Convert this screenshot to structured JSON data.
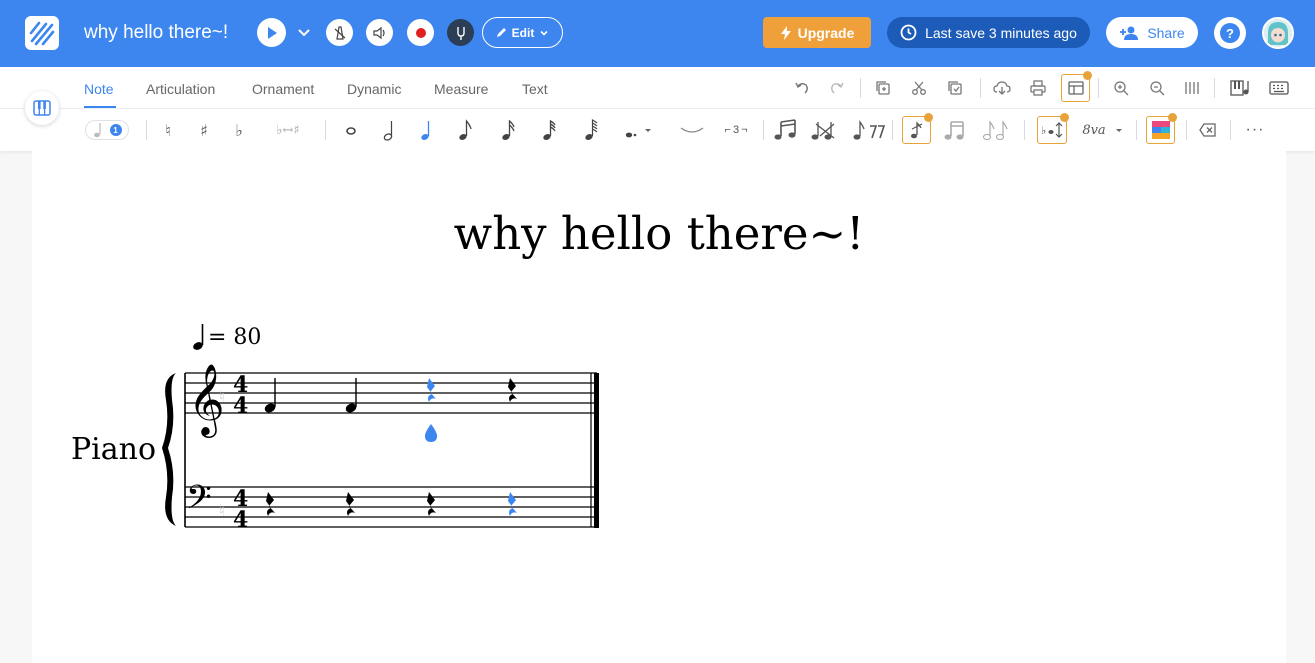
{
  "header": {
    "title": "why hello there~!",
    "edit_label": "Edit",
    "upgrade_label": "Upgrade",
    "last_save": "Last save 3 minutes ago",
    "share_label": "Share",
    "help_glyph": "?"
  },
  "tabs": [
    {
      "label": "Note",
      "active": true
    },
    {
      "label": "Articulation"
    },
    {
      "label": "Ornament"
    },
    {
      "label": "Dynamic"
    },
    {
      "label": "Measure"
    },
    {
      "label": "Text"
    }
  ],
  "note_toolbar": {
    "voice_badge": "1",
    "triplet_label": "3",
    "ottava_label": "8va"
  },
  "score": {
    "title": "why hello there~!",
    "tempo_value": "= 80",
    "instrument": "Piano",
    "time_signature_top": "4",
    "time_signature_bottom": "4",
    "treble_notes": [
      "quarter",
      "quarter",
      "quarter-rest (selected)",
      "quarter-rest"
    ],
    "bass_notes": [
      "quarter-rest",
      "quarter-rest",
      "quarter-rest",
      "quarter-rest (selected)"
    ]
  },
  "colors": {
    "brand_blue": "#3d86f0",
    "upgrade_orange": "#f0a03a",
    "save_pill": "#1c5bb8",
    "selection": "#3d86f0"
  },
  "icons": {
    "play": "play-icon",
    "metronome": "metronome-off-icon",
    "speaker": "speaker-icon",
    "record": "record-icon",
    "tuning": "tuning-fork-icon"
  }
}
